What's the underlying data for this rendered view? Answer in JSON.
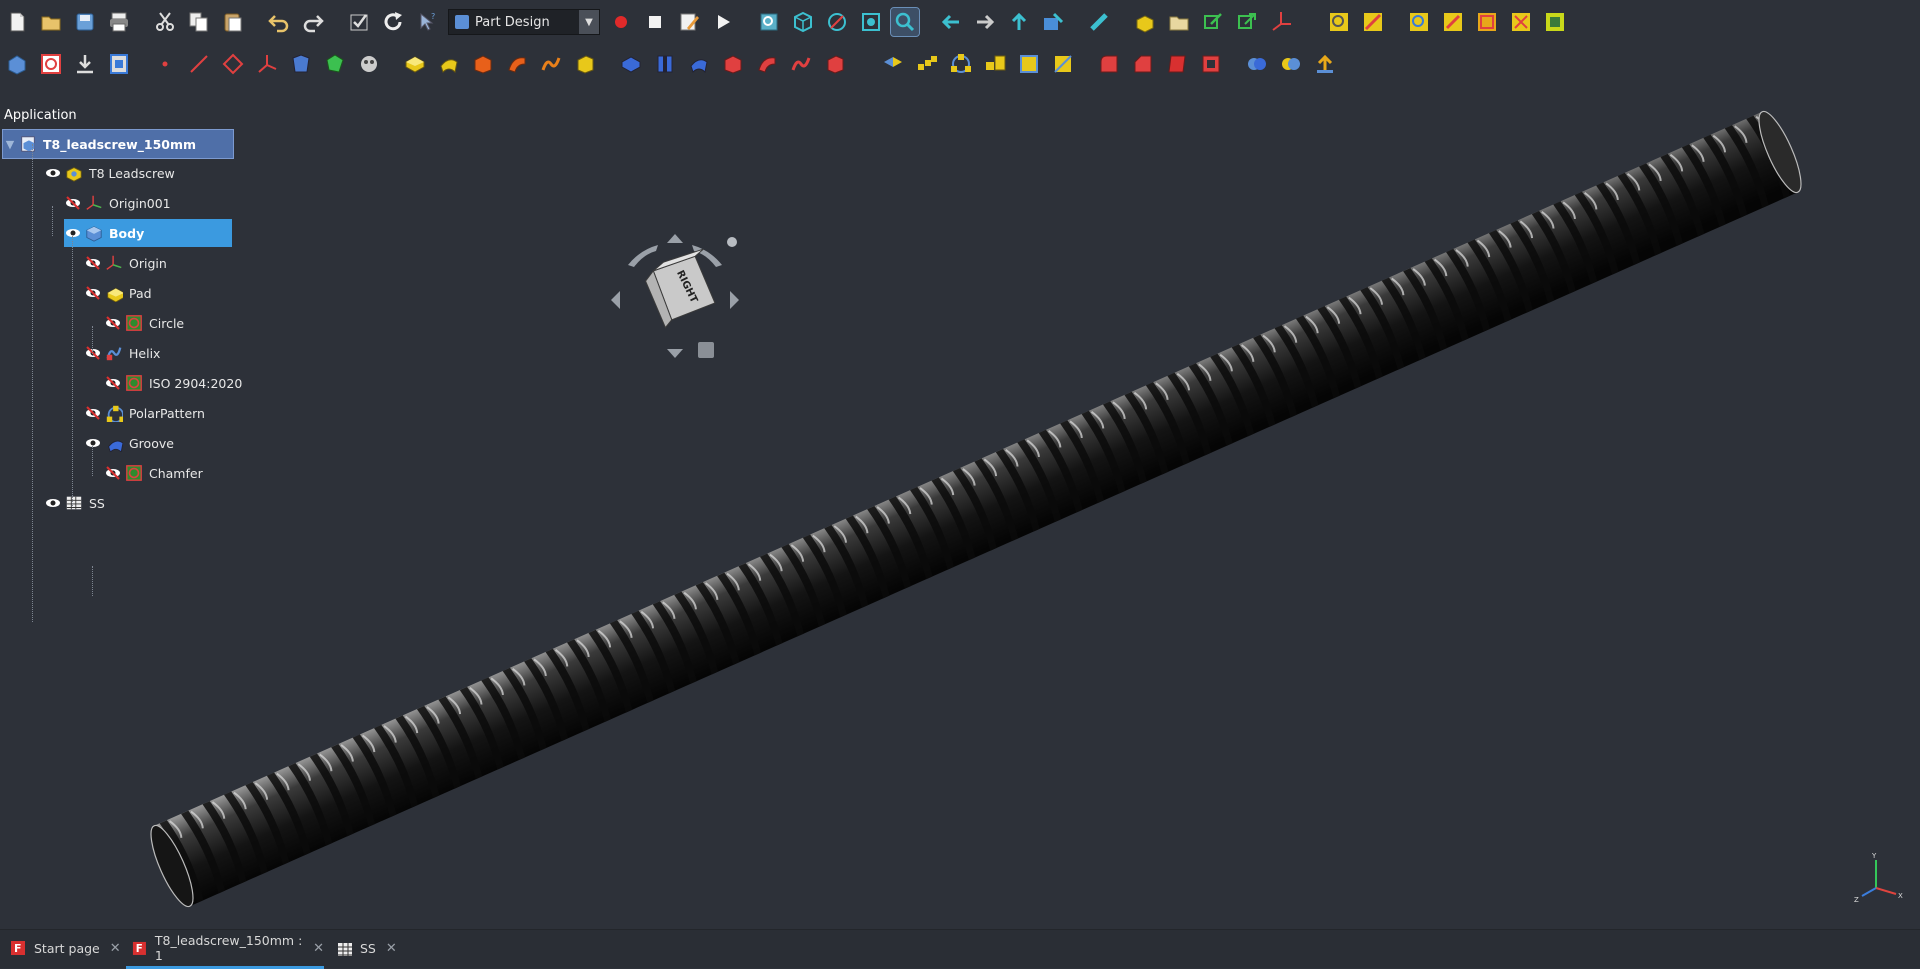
{
  "toolbar": {
    "workbench_selector": {
      "value": "Part Design"
    },
    "row1": [
      {
        "name": "new-file-icon"
      },
      {
        "name": "open-file-icon"
      },
      {
        "name": "save-icon"
      },
      {
        "name": "print-icon"
      },
      {
        "name": "sep"
      },
      {
        "name": "cut-icon"
      },
      {
        "name": "copy-icon"
      },
      {
        "name": "paste-icon"
      },
      {
        "name": "sep"
      },
      {
        "name": "undo-icon"
      },
      {
        "name": "redo-icon"
      },
      {
        "name": "sep"
      },
      {
        "name": "recompute-check-icon"
      },
      {
        "name": "refresh-icon"
      },
      {
        "name": "whats-this-icon"
      },
      {
        "name": "workbench"
      },
      {
        "name": "record-macro-icon"
      },
      {
        "name": "stop-macro-icon"
      },
      {
        "name": "edit-macro-icon"
      },
      {
        "name": "run-macro-icon"
      },
      {
        "name": "sep"
      },
      {
        "name": "fit-all-icon"
      },
      {
        "name": "isometric-view-icon"
      },
      {
        "name": "draw-style-icon"
      },
      {
        "name": "bounding-box-icon"
      },
      {
        "name": "zoom-selection-icon",
        "active": true
      },
      {
        "name": "sep"
      },
      {
        "name": "back-arrow-icon"
      },
      {
        "name": "forward-arrow-icon"
      },
      {
        "name": "up-arrow-icon"
      },
      {
        "name": "measure-view-icon"
      },
      {
        "name": "sep"
      },
      {
        "name": "measure-ruler-icon"
      },
      {
        "name": "sep"
      },
      {
        "name": "create-part-icon"
      },
      {
        "name": "create-group-icon"
      },
      {
        "name": "link-make-icon"
      },
      {
        "name": "link-sub-icon"
      },
      {
        "name": "axes-cross-icon"
      },
      {
        "name": "sep"
      },
      {
        "name": "sep"
      },
      {
        "name": "view-measure-1-icon"
      },
      {
        "name": "view-measure-2-icon"
      },
      {
        "name": "sep"
      },
      {
        "name": "analysis-1-icon"
      },
      {
        "name": "analysis-2-icon"
      },
      {
        "name": "analysis-3-icon"
      },
      {
        "name": "analysis-4-icon"
      },
      {
        "name": "analysis-5-icon"
      }
    ],
    "row2": [
      {
        "name": "create-body-icon"
      },
      {
        "name": "create-sketch-icon"
      },
      {
        "name": "import-icon"
      },
      {
        "name": "validate-sketch-icon"
      },
      {
        "name": "sep"
      },
      {
        "name": "datum-point-icon"
      },
      {
        "name": "datum-line-icon"
      },
      {
        "name": "datum-plane-icon"
      },
      {
        "name": "local-cs-icon"
      },
      {
        "name": "shape-binder-icon"
      },
      {
        "name": "subshape-binder-icon"
      },
      {
        "name": "clone-icon"
      },
      {
        "name": "sep"
      },
      {
        "name": "pad-icon"
      },
      {
        "name": "revolution-icon"
      },
      {
        "name": "additive-loft-icon"
      },
      {
        "name": "additive-pipe-icon"
      },
      {
        "name": "additive-helix-icon"
      },
      {
        "name": "additive-box-icon"
      },
      {
        "name": "sep"
      },
      {
        "name": "pocket-icon"
      },
      {
        "name": "hole-icon"
      },
      {
        "name": "groove-icon"
      },
      {
        "name": "subtractive-loft-icon"
      },
      {
        "name": "subtractive-pipe-icon"
      },
      {
        "name": "subtractive-helix-icon"
      },
      {
        "name": "subtractive-box-icon"
      },
      {
        "name": "sep"
      },
      {
        "name": "sep"
      },
      {
        "name": "mirrored-icon"
      },
      {
        "name": "linear-pattern-icon"
      },
      {
        "name": "polar-pattern-icon"
      },
      {
        "name": "scaled-icon"
      },
      {
        "name": "multi-transform-icon"
      },
      {
        "name": "multi-transform-2-icon"
      },
      {
        "name": "sep"
      },
      {
        "name": "fillet-icon"
      },
      {
        "name": "chamfer-icon"
      },
      {
        "name": "draft-icon"
      },
      {
        "name": "thickness-icon"
      },
      {
        "name": "sep"
      },
      {
        "name": "boolean-icon"
      },
      {
        "name": "boolean-2-icon"
      },
      {
        "name": "sprocket-icon"
      }
    ]
  },
  "tree": {
    "header": "Application",
    "items": [
      {
        "label": "T8_leadscrew_150mm",
        "depth": 0,
        "eye": false,
        "icon": "document-icon",
        "root": true
      },
      {
        "label": "T8 Leadscrew",
        "depth": 1,
        "eye": true,
        "icon": "part-icon"
      },
      {
        "label": "Origin001",
        "depth": 2,
        "eye": "hidden",
        "icon": "origin-icon"
      },
      {
        "label": "Body",
        "depth": 2,
        "eye": true,
        "icon": "body-icon",
        "selected": true
      },
      {
        "label": "Origin",
        "depth": 3,
        "eye": "hidden",
        "icon": "origin-icon"
      },
      {
        "label": "Pad",
        "depth": 3,
        "eye": "hidden",
        "icon": "pad-icon"
      },
      {
        "label": "Circle",
        "depth": 4,
        "eye": "hidden",
        "icon": "sketch-icon"
      },
      {
        "label": "Helix",
        "depth": 3,
        "eye": "hidden",
        "icon": "helix-icon"
      },
      {
        "label": "ISO 2904:2020",
        "depth": 4,
        "eye": "hidden",
        "icon": "sketch-icon"
      },
      {
        "label": "PolarPattern",
        "depth": 3,
        "eye": "hidden",
        "icon": "polar-pattern-icon"
      },
      {
        "label": "Groove",
        "depth": 3,
        "eye": true,
        "icon": "groove-icon"
      },
      {
        "label": "Chamfer",
        "depth": 4,
        "eye": "hidden",
        "icon": "sketch-icon"
      },
      {
        "label": "SS",
        "depth": 1,
        "eye": true,
        "icon": "spreadsheet-icon"
      }
    ]
  },
  "navcube": {
    "face_label": "RIGHT"
  },
  "axes": {
    "x": "X",
    "y": "Y",
    "z": "Z"
  },
  "tabs": [
    {
      "label": "Start page",
      "icon": "freecad-icon",
      "active": false
    },
    {
      "label": "T8_leadscrew_150mm : 1",
      "icon": "freecad-icon",
      "active": true
    },
    {
      "label": "SS",
      "icon": "spreadsheet-icon",
      "active": false
    }
  ],
  "colors": {
    "background": "#2d3139",
    "selection": "#3b9ae0",
    "screw": "#1a1a1a"
  }
}
